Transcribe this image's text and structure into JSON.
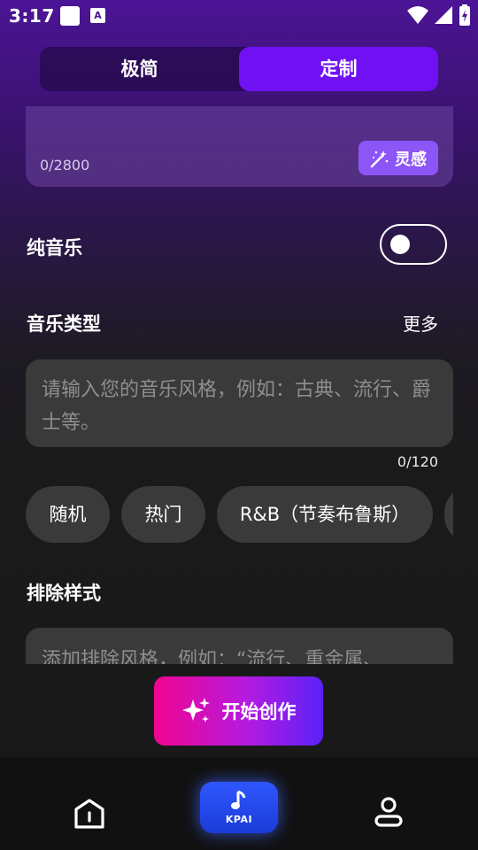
{
  "status_bar": {
    "time": "3:17",
    "app_icon_letter": "A"
  },
  "tabs": [
    {
      "label": "极简"
    },
    {
      "label": "定制"
    }
  ],
  "lyrics": {
    "count": "0/2800",
    "inspire_label": "灵感"
  },
  "pure_music": {
    "label": "纯音乐",
    "enabled": false
  },
  "genre": {
    "label": "音乐类型",
    "more_label": "更多",
    "placeholder": "请输入您的音乐风格，例如：古典、流行、爵士等。",
    "count": "0/120",
    "chips": [
      "随机",
      "热门",
      "R&B（节奏布鲁斯）"
    ]
  },
  "exclude": {
    "label": "排除样式",
    "placeholder": "添加排除风格，例如：“流行、重金属、"
  },
  "create_button": {
    "label": "开始创作"
  },
  "bottom_nav": {
    "center_label": "KPAI"
  },
  "colors": {
    "accent": "#7011f3",
    "inspire": "#8c55f5",
    "create_start": "#f1068f",
    "create_end": "#5b22f8",
    "kpai": "#2f57ff"
  }
}
